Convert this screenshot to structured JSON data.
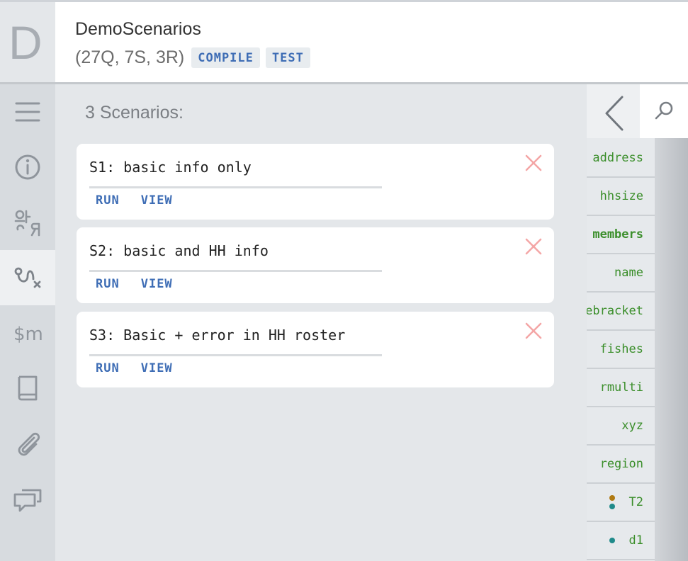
{
  "header": {
    "logo_letter": "D",
    "title": "DemoScenarios",
    "counts": "(27Q, 7S, 3R)",
    "compile_label": "COMPILE",
    "test_label": "TEST"
  },
  "rail": {
    "items": [
      {
        "icon": "menu-icon"
      },
      {
        "icon": "info-icon"
      },
      {
        "icon": "translate-icon"
      },
      {
        "icon": "scenarios-icon",
        "active": true
      },
      {
        "icon": "macros-icon"
      },
      {
        "icon": "book-icon"
      },
      {
        "icon": "attachment-icon"
      },
      {
        "icon": "comments-icon"
      }
    ]
  },
  "main": {
    "count_label": "3 Scenarios:",
    "scenarios": [
      {
        "title": "S1: basic info only",
        "run_label": "RUN",
        "view_label": "VIEW"
      },
      {
        "title": "S2: basic and HH info",
        "run_label": "RUN",
        "view_label": "VIEW"
      },
      {
        "title": "S3: Basic + error in HH roster",
        "run_label": "RUN",
        "view_label": "VIEW"
      }
    ]
  },
  "right_panel": {
    "items": [
      {
        "label": "address"
      },
      {
        "label": "hhsize"
      },
      {
        "label": "members",
        "bold": true
      },
      {
        "label": "name"
      },
      {
        "label": "agebracket"
      },
      {
        "label": "fishes"
      },
      {
        "label": "rmulti"
      },
      {
        "label": "xyz"
      },
      {
        "label": "region"
      },
      {
        "label": "T2",
        "dots": [
          "#b07a12",
          "#1f8a8a"
        ]
      },
      {
        "label": "d1",
        "dots": [
          "#1f8a8a"
        ]
      }
    ]
  },
  "colors": {
    "accent": "#3e6db5",
    "variable_green": "#3c8f2c",
    "close_red": "#f4a6a6"
  }
}
